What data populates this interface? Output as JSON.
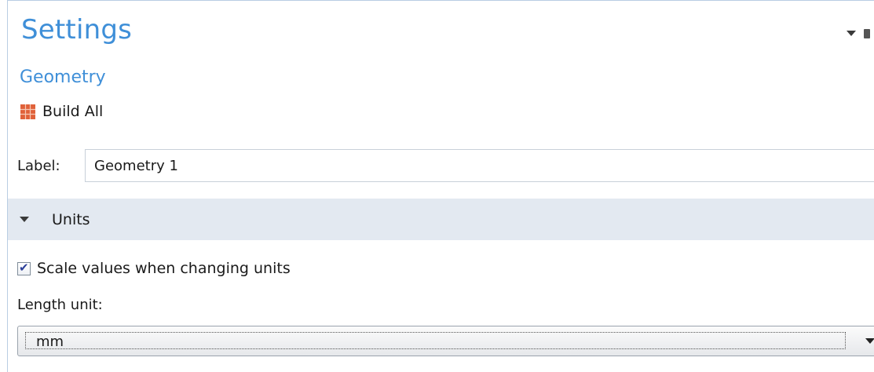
{
  "header": {
    "title": "Settings",
    "subtitle": "Geometry"
  },
  "toolbar": {
    "build_all_label": "Build All",
    "build_icon": "build-all-grid-icon"
  },
  "label_field": {
    "label": "Label:",
    "value": "Geometry 1"
  },
  "units_section": {
    "title": "Units",
    "expanded": true,
    "scale_checkbox": {
      "label": "Scale values when changing units",
      "checked": true
    },
    "length_unit": {
      "label": "Length unit:",
      "selected": "mm"
    }
  },
  "colors": {
    "title_blue": "#3f8fd8",
    "section_bg": "#e3e9f1",
    "build_icon_orange": "#e0623a",
    "checkmark_blue": "#2c3f99"
  }
}
